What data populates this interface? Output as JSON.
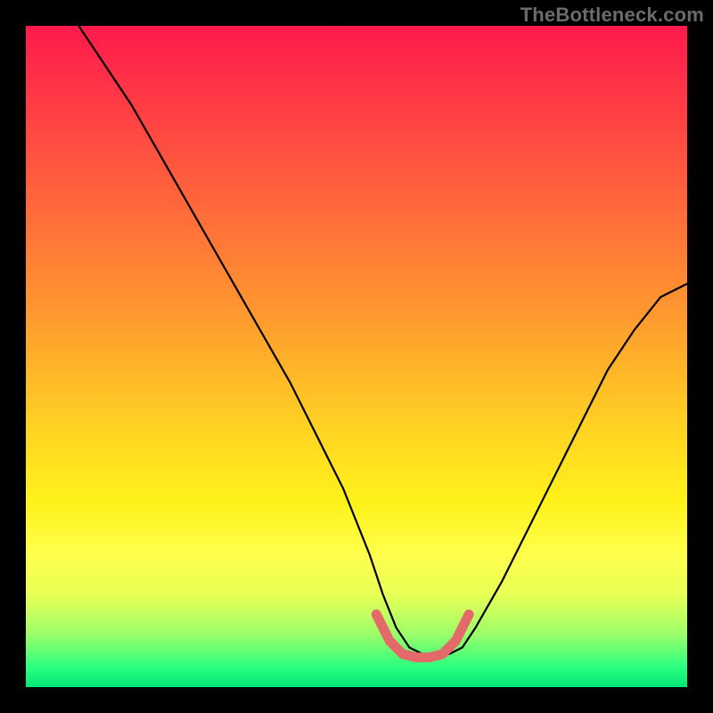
{
  "watermark": "TheBottleneck.com",
  "chart_data": {
    "type": "line",
    "title": "",
    "xlabel": "",
    "ylabel": "",
    "xlim": [
      0,
      100
    ],
    "ylim": [
      0,
      100
    ],
    "grid": false,
    "legend": false,
    "series": [
      {
        "name": "bottleneck-curve",
        "color": "#000000",
        "x": [
          8,
          12,
          16,
          20,
          24,
          28,
          32,
          36,
          40,
          44,
          48,
          52,
          54,
          56,
          58,
          60,
          62,
          64,
          66,
          68,
          72,
          76,
          80,
          84,
          88,
          92,
          96,
          100
        ],
        "y": [
          100,
          94,
          88,
          81,
          74,
          67,
          60,
          53,
          46,
          38,
          30,
          20,
          14,
          9,
          6,
          5,
          5,
          5,
          6,
          9,
          16,
          24,
          32,
          40,
          48,
          54,
          59,
          61
        ]
      },
      {
        "name": "flat-bottom-highlight",
        "color": "#e46a6a",
        "x": [
          53,
          55,
          57,
          59,
          61,
          63,
          65,
          67
        ],
        "y": [
          11,
          7,
          5,
          4.5,
          4.5,
          5,
          7,
          11
        ]
      }
    ]
  },
  "colors": {
    "frame": "#000000",
    "gradient_top": "#ff1a4d",
    "gradient_mid": "#fff21a",
    "gradient_bottom": "#00e676",
    "curve": "#000000",
    "highlight": "#e46a6a",
    "watermark": "#6b6b6b"
  }
}
